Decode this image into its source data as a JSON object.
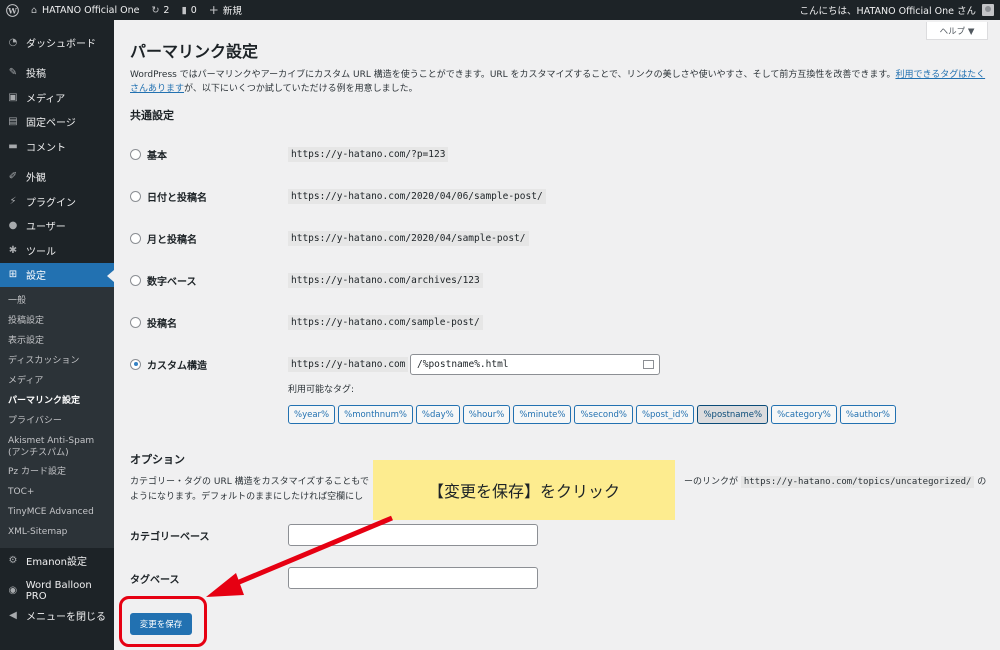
{
  "adminbar": {
    "site_name": "HATANO Official One",
    "updates_count": "2",
    "comments_count": "0",
    "new_label": "新規",
    "greeting": "こんにちは、HATANO Official One さん"
  },
  "sidebar": {
    "items_top": [
      {
        "label": "ダッシュボード",
        "icon": "dashboard-icon",
        "glyph": "◔"
      },
      {
        "label": "投稿",
        "icon": "pushpin-icon",
        "glyph": "✎"
      },
      {
        "label": "メディア",
        "icon": "media-icon",
        "glyph": "▣"
      },
      {
        "label": "固定ページ",
        "icon": "page-icon",
        "glyph": "▤"
      },
      {
        "label": "コメント",
        "icon": "comment-icon",
        "glyph": "▬"
      },
      {
        "label": "外観",
        "icon": "brush-icon",
        "glyph": "✐"
      },
      {
        "label": "プラグイン",
        "icon": "plugin-icon",
        "glyph": "⚡"
      },
      {
        "label": "ユーザー",
        "icon": "user-icon",
        "glyph": "●"
      },
      {
        "label": "ツール",
        "icon": "wrench-icon",
        "glyph": "✱"
      },
      {
        "label": "設定",
        "icon": "settings-icon",
        "glyph": "⊞"
      }
    ],
    "submenu": [
      "一般",
      "投稿設定",
      "表示設定",
      "ディスカッション",
      "メディア",
      "パーマリンク設定",
      "プライバシー",
      "Akismet Anti-Spam (アンチスパム)",
      "Pz カード設定",
      "TOC+",
      "TinyMCE Advanced",
      "XML-Sitemap"
    ],
    "items_bottom": [
      {
        "label": "Emanon設定",
        "icon": "gear-icon",
        "glyph": "⚙"
      },
      {
        "label": "Word Balloon PRO",
        "icon": "balloon-icon",
        "glyph": "◉"
      },
      {
        "label": "メニューを閉じる",
        "icon": "collapse-icon",
        "glyph": "◀"
      }
    ]
  },
  "help_label": "ヘルプ ▼",
  "page": {
    "title": "パーマリンク設定",
    "intro_text": "WordPress ではパーマリンクやアーカイブにカスタム URL 構造を使うことができます。URL をカスタマイズすることで、リンクの美しさや使いやすさ、そして前方互換性を改善できます。",
    "intro_link": "利用できるタグはたくさんあります",
    "intro_tail": "が、以下にいくつか試していただける例を用意しました。",
    "common_title": "共通設定"
  },
  "permalink_options": [
    {
      "label": "基本",
      "example": "https://y-hatano.com/?p=123",
      "checked": false
    },
    {
      "label": "日付と投稿名",
      "example": "https://y-hatano.com/2020/04/06/sample-post/",
      "checked": false
    },
    {
      "label": "月と投稿名",
      "example": "https://y-hatano.com/2020/04/sample-post/",
      "checked": false
    },
    {
      "label": "数字ベース",
      "example": "https://y-hatano.com/archives/123",
      "checked": false
    },
    {
      "label": "投稿名",
      "example": "https://y-hatano.com/sample-post/",
      "checked": false
    },
    {
      "label": "カスタム構造",
      "example": "https://y-hatano.com",
      "checked": true
    }
  ],
  "custom_structure_value": "/%postname%.html",
  "available_tags_label": "利用可能なタグ:",
  "tags": [
    "%year%",
    "%monthnum%",
    "%day%",
    "%hour%",
    "%minute%",
    "%second%",
    "%post_id%",
    "%postname%",
    "%category%",
    "%author%"
  ],
  "active_tag": "%postname%",
  "options": {
    "title": "オプション",
    "desc_part1": "カテゴリー・タグの URL 構造をカスタマイズすることもで",
    "desc_part2": "ーのリンクが",
    "desc_code": "https://y-hatano.com/topics/uncategorized/",
    "desc_part3": "の",
    "desc_line2": "ようになります。デフォルトのままにしたければ空欄にし",
    "category_base_label": "カテゴリーベース",
    "category_base_value": "",
    "tag_base_label": "タグベース",
    "tag_base_value": ""
  },
  "save_button_label": "変更を保存",
  "annotation": {
    "callout_text": "【変更を保存】をクリック",
    "accent_color": "#e60012",
    "callout_color": "#fdec8f"
  }
}
